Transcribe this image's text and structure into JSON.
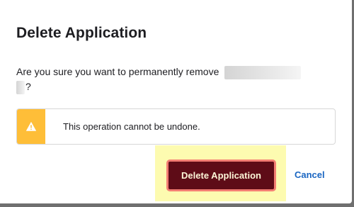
{
  "dialog": {
    "title": "Delete Application",
    "message_prefix": "Are you sure you want to permanently remove",
    "message_suffix": "?",
    "warning_text": "This operation cannot be undone.",
    "delete_label": "Delete Application",
    "cancel_label": "Cancel"
  },
  "icons": {
    "warning": "warning-triangle-icon"
  },
  "colors": {
    "warning_stripe": "#febe38",
    "delete_button_bg": "#5e0c17",
    "delete_button_border": "#f37e73",
    "highlight": "#fdfbb0",
    "cancel_link": "#1a66c2"
  }
}
